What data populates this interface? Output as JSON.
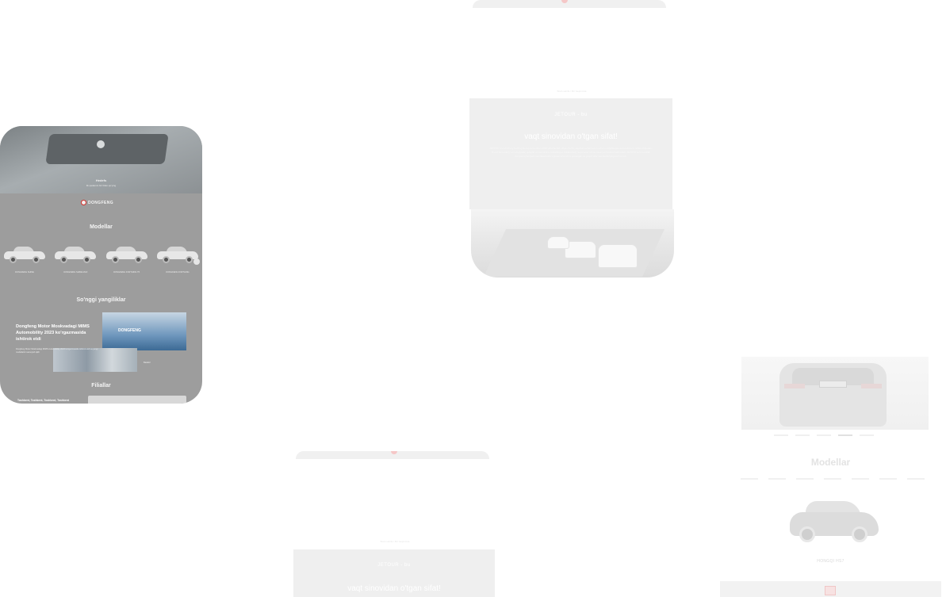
{
  "dongfeng_card": {
    "hero": {
      "title": "Hedefs",
      "subtitle": "Ilk qadamni biz bilan qo'ying"
    },
    "logo": {
      "word": "DONGFENG"
    },
    "models_title": "Modellar",
    "models": [
      {
        "label": "DONGFENG SHINE"
      },
      {
        "label": "DONGFENG SHINE MAX"
      },
      {
        "label": "DONGFENG FORTHING T5"
      },
      {
        "label": "DONGFENG FORTHING"
      }
    ],
    "news_title": "So'nggi yangiliklar",
    "news": {
      "headline": "Dongfeng Motor Moskvadagi MIMS Automobility 2023 ko'rgazmasida ishtirok etdi",
      "body": "Dongfeng Motor Moskvadagi MIMS Automobility 2023 ko'rgazmasida ishtirok etdi va yangi modellarini namoyish qildi",
      "image_brand": "DONGFENG",
      "more": "Batafsil"
    },
    "branches_title": "Filiallar",
    "branches_text": "Toshkent, Toshkent, Toshkent, Toshkent"
  },
  "jetour_card_top": {
    "breadcrumb": "Bosh sahifa / Biz haqimizda",
    "brand": "JETOUR - bu",
    "heading": "vaqt sinovidan o'tgan sifat!",
    "paragraph": "JETOUR brendi Chery Holding Group tomonidan 2018 yilda tashkil etilgan bo'lib, sayohat va dam olish uchun mo'ljallangan avtomobillarni ishlab chiqaradi. Brend zamonaviy texnologiyalar, qulaylik va xavfsizlikni birlashtirgan holda oilaviy sayohatlar uchun ideal yechimlarni taklif etadi. JETOUR avtomobillari dunyoning ko'plab mamlakatlarida mijozlar ishonchini qozongan va yuqori sifat standartlariga javob beradi."
  },
  "jetour_card_bottom": {
    "breadcrumb": "Bosh sahifa / Biz haqimizda",
    "brand": "JETOUR - bu",
    "heading": "vaqt sinovidan o'tgan sifat!"
  },
  "hongqi_card": {
    "models_title": "Modellar",
    "model_name": "HONGQI HS7"
  },
  "colors": {
    "dongfeng_overlay": "#9d9d9d",
    "jetour_panel": "#efefef",
    "hongqi_red": "#d3312c"
  }
}
